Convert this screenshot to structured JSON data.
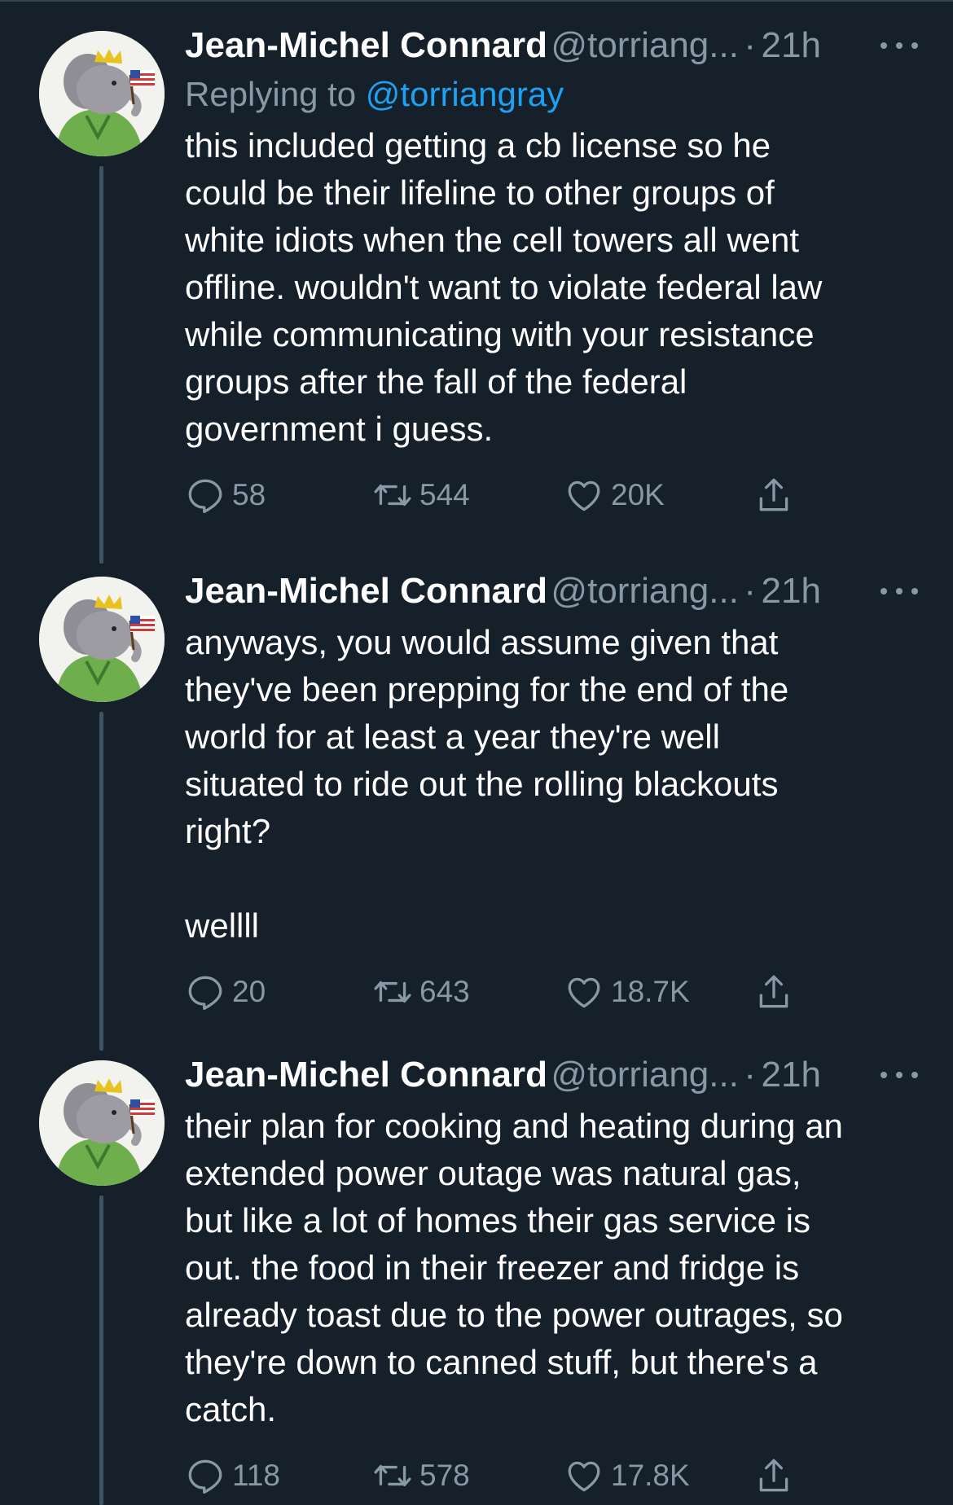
{
  "tweets": [
    {
      "name": "Jean-Michel Connard",
      "handle": "@torriang...",
      "separator": "·",
      "time": "21h",
      "replying_label": "Replying to ",
      "replying_to": "@torriangray",
      "text": "this included getting a cb license so he\ncould be their lifeline to other groups of\nwhite idiots when the cell towers all went\noffline. wouldn't want to violate federal law\nwhile communicating with your resistance\ngroups after the fall of the federal\ngovernment i guess.",
      "replies": "58",
      "retweets": "544",
      "likes": "20K"
    },
    {
      "name": "Jean-Michel Connard",
      "handle": "@torriang...",
      "separator": "·",
      "time": "21h",
      "text": "anyways, you would assume given that\nthey've been prepping for the end of the\nworld for at least a year they're well\nsituated to ride out the rolling blackouts\nright?\n\nwellll",
      "replies": "20",
      "retweets": "643",
      "likes": "18.7K"
    },
    {
      "name": "Jean-Michel Connard",
      "handle": "@torriang...",
      "separator": "·",
      "time": "21h",
      "text": "their plan for cooking and heating during an\nextended power outage was natural gas,\nbut like a lot of homes their gas service is\nout. the food in their freezer and fridge is\nalready toast due to the power outrages, so\nthey're down to canned stuff, but there's a\ncatch.",
      "replies": "118",
      "retweets": "578",
      "likes": "17.8K"
    }
  ],
  "colors": {
    "background": "#15202b",
    "secondary_text": "#8899a6",
    "link": "#1da1f2",
    "thread_line": "#3d5466"
  },
  "icons": [
    "reply-icon",
    "retweet-icon",
    "like-icon",
    "share-icon",
    "more-icon"
  ]
}
